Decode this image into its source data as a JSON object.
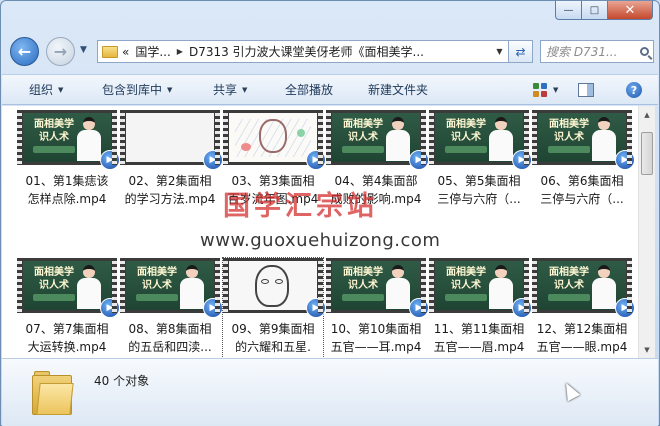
{
  "window": {
    "caption_buttons": {
      "minimize": "—",
      "maximize": "□",
      "close": "✕"
    }
  },
  "nav": {
    "back_icon": "arrow-left-icon",
    "forward_icon": "arrow-right-icon",
    "address_segments": [
      "国学...",
      "D7313 引力波大课堂美伢老师《面相美学..."
    ],
    "address_prefix": "«",
    "search_placeholder": "搜索 D731..."
  },
  "toolbar": {
    "organize": "组织",
    "include_in_library": "包含到库中",
    "share": "共享",
    "play_all": "全部播放",
    "new_folder": "新建文件夹",
    "help": "?"
  },
  "thumbnails": {
    "green_title_line1": "面相美学",
    "green_title_line2": "识人术"
  },
  "files": [
    {
      "line1": "01、第1集痣该",
      "line2": "怎样点除.mp4",
      "thumb": "green"
    },
    {
      "line1": "02、第2集面相",
      "line2": "的学习方法.mp4",
      "thumb": "blank"
    },
    {
      "line1": "03、第3集面相",
      "line2": "百岁流年图.mp4",
      "thumb": "drawing"
    },
    {
      "line1": "04、第4集面部",
      "line2": "成败的影响.mp4",
      "thumb": "green"
    },
    {
      "line1": "05、第5集面相",
      "line2": "三停与六府（...",
      "thumb": "green"
    },
    {
      "line1": "06、第6集面相",
      "line2": "三停与六府（...",
      "thumb": "green"
    },
    {
      "line1": "07、第7集面相",
      "line2": "大运转换.mp4",
      "thumb": "green"
    },
    {
      "line1": "08、第8集面相",
      "line2": "的五岳和四渎...",
      "thumb": "green"
    },
    {
      "line1": "09、第9集面相",
      "line2": "的六耀和五星.",
      "thumb": "sketch"
    },
    {
      "line1": "10、第10集面相",
      "line2": "五官——耳.mp4",
      "thumb": "green"
    },
    {
      "line1": "11、第11集面相",
      "line2": "五官——眉.mp4",
      "thumb": "green"
    },
    {
      "line1": "12、第12集面相",
      "line2": "五官——眼.mp4",
      "thumb": "green"
    }
  ],
  "watermark": {
    "title": "国学汇宗站",
    "url": "www.guoxuehuizong.com"
  },
  "details": {
    "count": "40 个对象"
  },
  "colors": {
    "window_frame": "#c5d9f0",
    "selection_blue": "#2a6cc2",
    "watermark_red": "#d22828",
    "thumb_green": "#2f5b46"
  }
}
